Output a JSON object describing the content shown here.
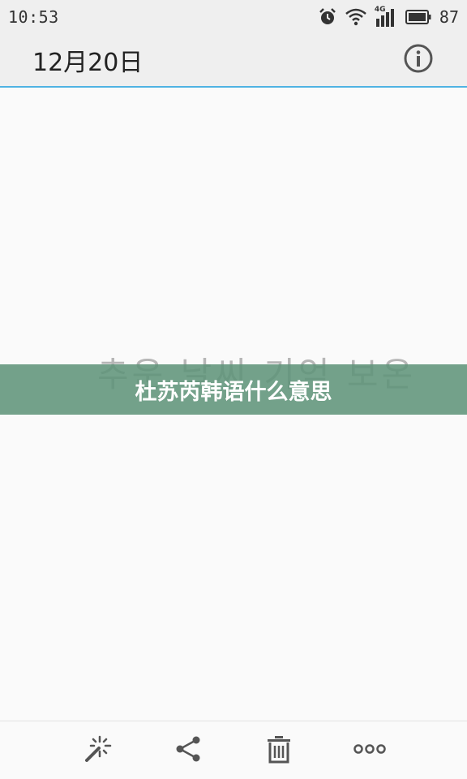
{
  "status_bar": {
    "time": "10:53",
    "network": "4G",
    "battery": "87",
    "icons": [
      "alarm-icon",
      "wifi-icon",
      "signal-icon",
      "battery-icon"
    ]
  },
  "header": {
    "title": "12月20日",
    "info_icon": "info-icon"
  },
  "content": {
    "ghost_text": "추운 날씨 기억 보온"
  },
  "banner": {
    "text": "杜苏芮韩语什么意思",
    "color": "#60947a"
  },
  "toolbar": {
    "items": [
      "magic-wand-icon",
      "share-icon",
      "trash-icon",
      "more-icon"
    ]
  },
  "colors": {
    "accent_line": "#4fb3e3",
    "bar_bg": "#efefef",
    "icon": "#555555"
  }
}
